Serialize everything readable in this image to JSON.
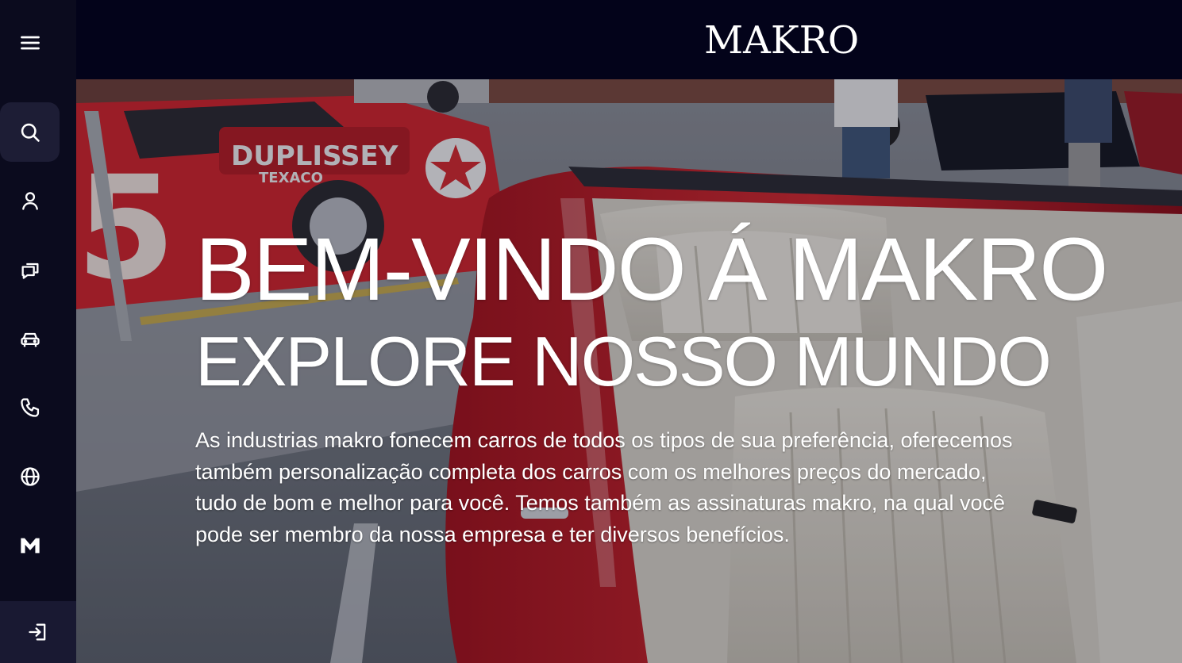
{
  "app": {
    "brand": "MAKRO"
  },
  "sidebar": {
    "items": [
      {
        "icon": "menu-icon"
      },
      {
        "icon": "search-icon",
        "active": true
      },
      {
        "icon": "user-icon"
      },
      {
        "icon": "chat-icon"
      },
      {
        "icon": "car-icon"
      },
      {
        "icon": "phone-icon"
      },
      {
        "icon": "globe-icon"
      },
      {
        "icon": "makro-logo-icon"
      },
      {
        "icon": "logout-icon"
      }
    ]
  },
  "hero": {
    "title": "BEM-VINDO Á MAKRO",
    "subtitle": "EXPLORE NOSSO MUNDO",
    "description": "As industrias makro fonecem carros de todos os tipos de sua preferência, oferecemos também personalização completa dos carros com os melhores preços do mercado, tudo de bom e melhor para você. Temos também as assinaturas makro, na qual você pode ser membro da nossa empresa e ter diversos benefícios."
  },
  "colors": {
    "sidebar_bg": "#0b0b1e",
    "topbar_bg": "#03031a",
    "active_item_bg": "#1d1d35",
    "text": "#ffffff"
  }
}
